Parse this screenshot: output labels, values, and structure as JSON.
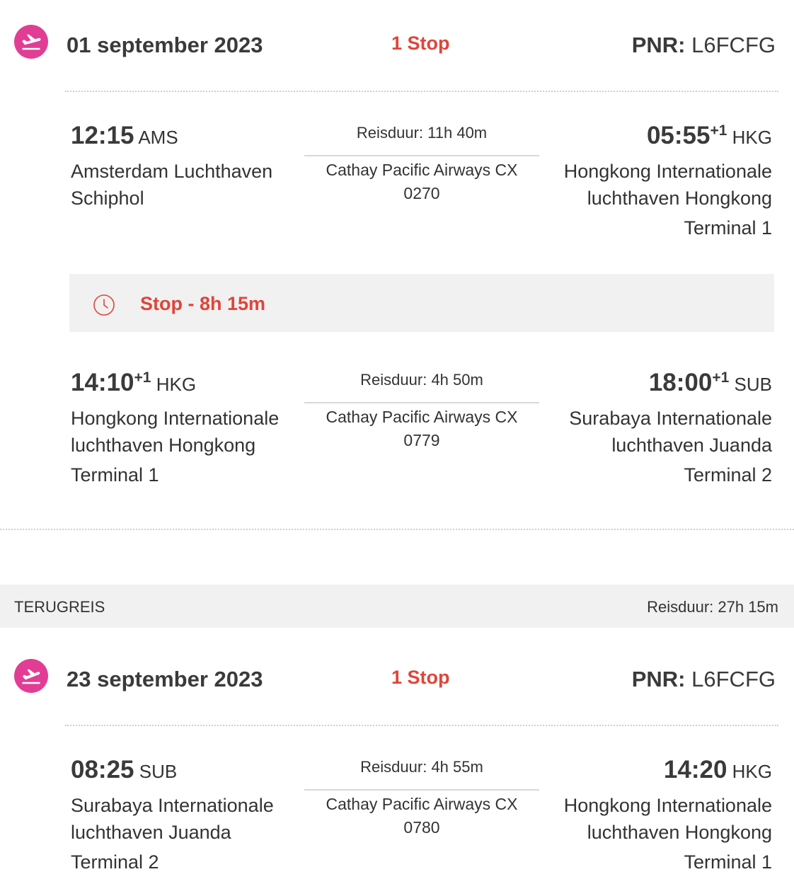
{
  "outbound": {
    "date": "01 september 2023",
    "stops": "1 Stop",
    "pnr_label": "PNR:",
    "pnr_value": "L6FCFG",
    "icon": "plane-departure-icon",
    "leg1": {
      "dep_time": "12:15",
      "dep_code": "AMS",
      "dep_place": "Amsterdam Luchthaven Schiphol",
      "duration": "Reisduur: 11h 40m",
      "airline": "Cathay Pacific Airways CX 0270",
      "arr_time": "05:55",
      "arr_plus": "+1",
      "arr_code": "HKG",
      "arr_place": "Hongkong Internationale luchthaven Hongkong",
      "arr_terminal": "Terminal 1"
    },
    "stop": {
      "text": "Stop - 8h 15m",
      "icon": "clock-icon"
    },
    "leg2": {
      "dep_time": "14:10",
      "dep_plus": "+1",
      "dep_code": "HKG",
      "dep_place": "Hongkong Internationale luchthaven Hongkong",
      "dep_terminal": "Terminal 1",
      "duration": "Reisduur: 4h 50m",
      "airline": "Cathay Pacific Airways CX 0779",
      "arr_time": "18:00",
      "arr_plus": "+1",
      "arr_code": "SUB",
      "arr_place": "Surabaya Internationale luchthaven Juanda",
      "arr_terminal": "Terminal 2"
    }
  },
  "return_bar": {
    "label": "TERUGREIS",
    "duration": "Reisduur: 27h 15m"
  },
  "return": {
    "date": "23 september 2023",
    "stops": "1 Stop",
    "pnr_label": "PNR:",
    "pnr_value": "L6FCFG",
    "icon": "plane-arrival-icon",
    "leg1": {
      "dep_time": "08:25",
      "dep_code": "SUB",
      "dep_place": "Surabaya Internationale luchthaven Juanda",
      "dep_terminal": "Terminal 2",
      "duration": "Reisduur: 4h 55m",
      "airline": "Cathay Pacific Airways CX 0780",
      "arr_time": "14:20",
      "arr_code": "HKG",
      "arr_place": "Hongkong Internationale luchthaven Hongkong",
      "arr_terminal": "Terminal 1"
    }
  },
  "colors": {
    "accent": "#e23d94",
    "stop_red": "#e0453a",
    "panel_grey": "#f1f1f1"
  }
}
